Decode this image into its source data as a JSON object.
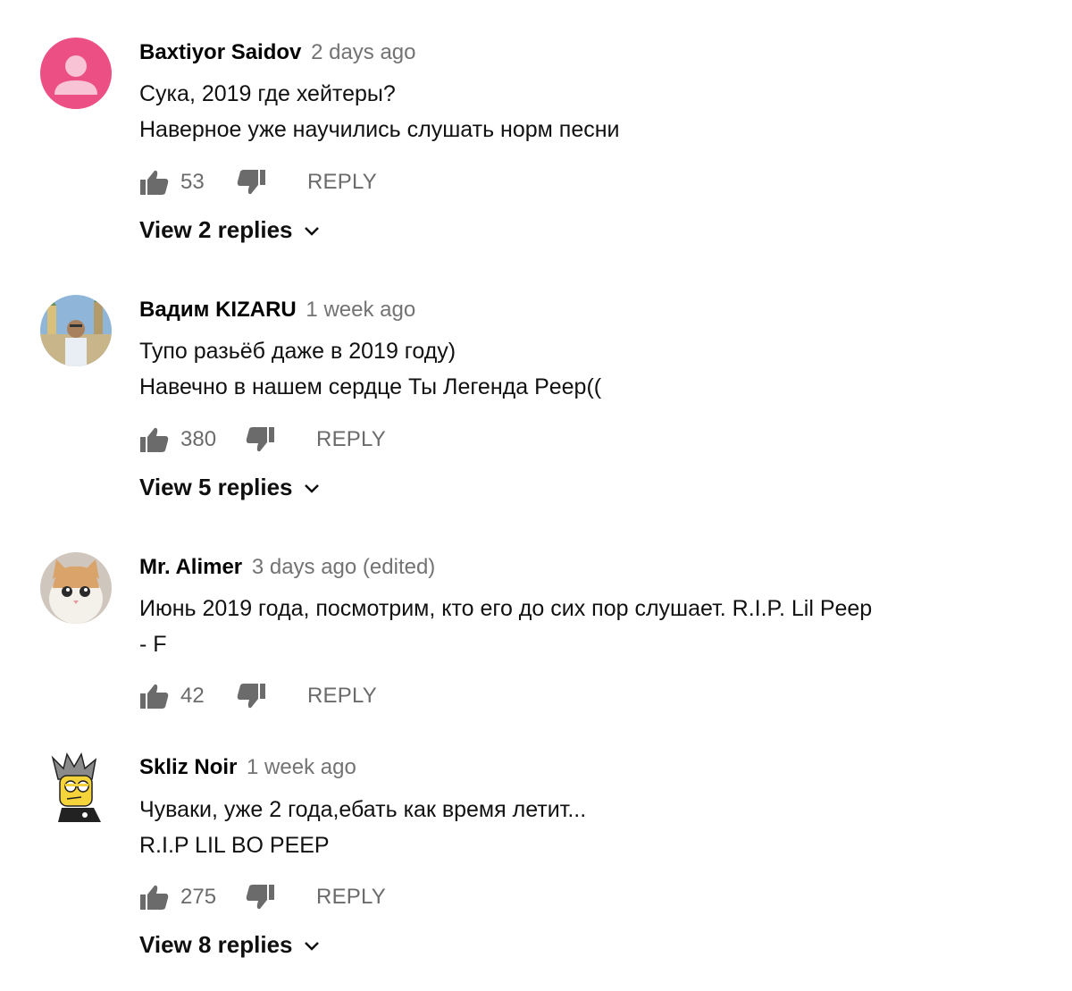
{
  "comments": [
    {
      "author": "Baxtiyor Saidov",
      "time": "2 days ago",
      "text_lines": [
        "Сука, 2019 где хейтеры?",
        "Наверное уже научились слушать норм песни"
      ],
      "likes": "53",
      "reply_label": "REPLY",
      "view_replies": "View 2 replies",
      "avatar_icon": "default-person-icon",
      "avatar_color": "#ec4f83"
    },
    {
      "author": "Вадим KIZARU",
      "time": "1 week ago",
      "text_lines": [
        "Тупо разьёб даже в 2019 году)",
        "Навечно в нашем сердце Ты Легенда Peep(("
      ],
      "likes": "380",
      "reply_label": "REPLY",
      "view_replies": "View 5 replies",
      "avatar_icon": "photo-avatar"
    },
    {
      "author": "Mr. Alimer",
      "time": "3 days ago (edited)",
      "text_lines": [
        "Июнь 2019 года, посмотрим, кто его до сих пор слушает. R.I.P. Lil Peep",
        "- F"
      ],
      "likes": "42",
      "reply_label": "REPLY",
      "view_replies": "",
      "avatar_icon": "cat-photo-avatar"
    },
    {
      "author": "Skliz Noir",
      "time": "1 week ago",
      "text_lines": [
        "Чуваки, уже 2 года,ебать как время летит...",
        "R.I.P LIL BO PEEP"
      ],
      "likes": "275",
      "reply_label": "REPLY",
      "view_replies": "View 8 replies",
      "avatar_icon": "cartoon-avatar"
    }
  ]
}
